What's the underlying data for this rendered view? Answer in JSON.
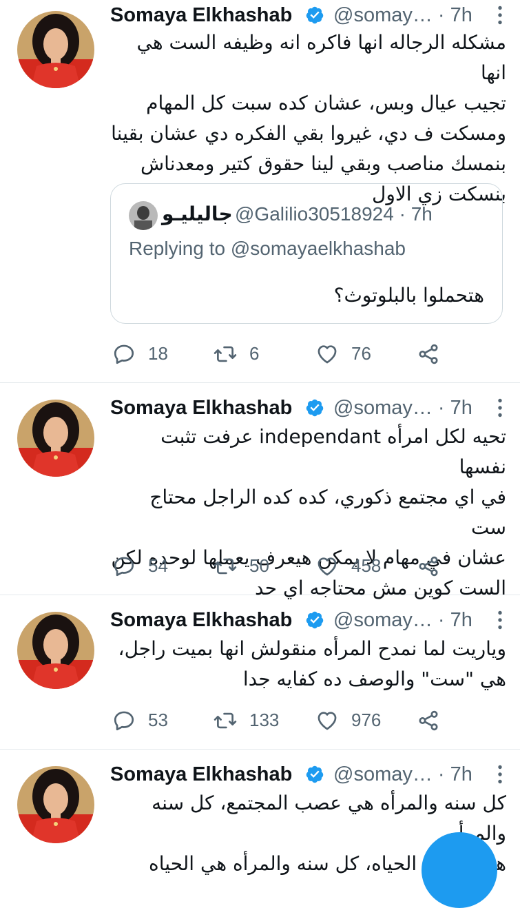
{
  "accent_color": "#1d9bf0",
  "tweets": [
    {
      "author": "Somaya Elkhashab",
      "handle": "@somay…",
      "time": "· 7h",
      "lines": [
        "مشكله الرجاله انها فاكره انه وظيفه الست هي انها",
        "تجيب عيال وبس، عشان كده سبت كل المهام",
        "ومسكت ف دي، غيروا بقي الفكره دي عشان بقينا",
        "بنمسك مناصب وبقي لينا حقوق كتير ومعدناش",
        "بنسكت زي الاول"
      ],
      "quote": {
        "author": "جاليليـو",
        "handle": "@Galilio30518924 · 7h",
        "replying": "Replying to @somayaelkhashab",
        "text": "هتحملوا بالبلوتوث؟"
      },
      "replies": "18",
      "retweets": "6",
      "likes": "76"
    },
    {
      "author": "Somaya Elkhashab",
      "handle": "@somay…",
      "time": "· 7h",
      "lines": [
        "تحيه لكل امرأه independant عرفت تثبت نفسها",
        "في اي مجتمع ذكوري، كده كده الراجل محتاج ست",
        "عشان في مهام لا يمكن هيعرف يعملها لوحده لكن",
        "الست كوين مش محتاجه اي حد"
      ],
      "replies": "54",
      "retweets": "50",
      "likes": "458"
    },
    {
      "author": "Somaya Elkhashab",
      "handle": "@somay…",
      "time": "· 7h",
      "lines": [
        "وياريت لما نمدح المرأه منقولش انها بميت راجل،",
        "هي \"ست\" والوصف ده كفايه جدا"
      ],
      "replies": "53",
      "retweets": "133",
      "likes": "976"
    },
    {
      "author": "Somaya Elkhashab",
      "handle": "@somay…",
      "time": "· 7h",
      "lines": [
        "كل سنه والمرأه هي عصب المجتمع، كل سنه والمرأه",
        "هي اساس الحياه، كل سنه والمرأه هي الحياه"
      ]
    }
  ]
}
